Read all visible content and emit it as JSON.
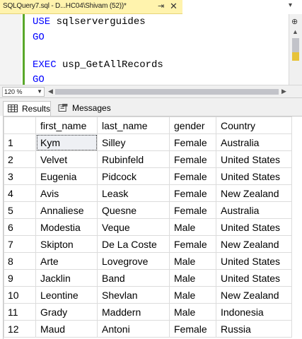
{
  "document_tab": {
    "title": "SQLQuery7.sql - D...HC04\\Shivam (52))*",
    "pin_icon": "pin-icon",
    "close_icon": "close-icon"
  },
  "editor": {
    "lines": [
      {
        "keyword": "USE",
        "text": " sqlserverguides"
      },
      {
        "keyword": "GO",
        "text": ""
      },
      {
        "keyword": "EXEC",
        "text": " usp_GetAllRecords"
      },
      {
        "keyword": "GO",
        "text": ""
      }
    ]
  },
  "zoom": {
    "value": "120 %"
  },
  "results_tabs": {
    "results_label": "Results",
    "messages_label": "Messages"
  },
  "grid": {
    "columns": [
      "first_name",
      "last_name",
      "gender",
      "Country"
    ],
    "rows": [
      {
        "n": "1",
        "first_name": "Kym",
        "last_name": "Silley",
        "gender": "Female",
        "country": "Australia"
      },
      {
        "n": "2",
        "first_name": "Velvet",
        "last_name": "Rubinfeld",
        "gender": "Female",
        "country": "United States"
      },
      {
        "n": "3",
        "first_name": "Eugenia",
        "last_name": "Pidcock",
        "gender": "Female",
        "country": "United States"
      },
      {
        "n": "4",
        "first_name": "Avis",
        "last_name": "Leask",
        "gender": "Female",
        "country": "New Zealand"
      },
      {
        "n": "5",
        "first_name": "Annaliese",
        "last_name": "Quesne",
        "gender": "Female",
        "country": "Australia"
      },
      {
        "n": "6",
        "first_name": "Modestia",
        "last_name": "Veque",
        "gender": "Male",
        "country": "United States"
      },
      {
        "n": "7",
        "first_name": "Skipton",
        "last_name": "De La Coste",
        "gender": "Female",
        "country": "New Zealand"
      },
      {
        "n": "8",
        "first_name": "Arte",
        "last_name": "Lovegrove",
        "gender": "Male",
        "country": "United States"
      },
      {
        "n": "9",
        "first_name": "Jacklin",
        "last_name": "Band",
        "gender": "Male",
        "country": "United States"
      },
      {
        "n": "10",
        "first_name": "Leontine",
        "last_name": "Shevlan",
        "gender": "Male",
        "country": "New Zealand"
      },
      {
        "n": "11",
        "first_name": "Grady",
        "last_name": "Maddern",
        "gender": "Male",
        "country": "Indonesia"
      },
      {
        "n": "12",
        "first_name": "Maud",
        "last_name": "Antoni",
        "gender": "Female",
        "country": "Russia"
      }
    ]
  },
  "colors": {
    "tab_active": "#fff3ad",
    "keyword": "#0000ff",
    "change_bar": "#5aa82a",
    "scroll_marker": "#e7c33a"
  }
}
